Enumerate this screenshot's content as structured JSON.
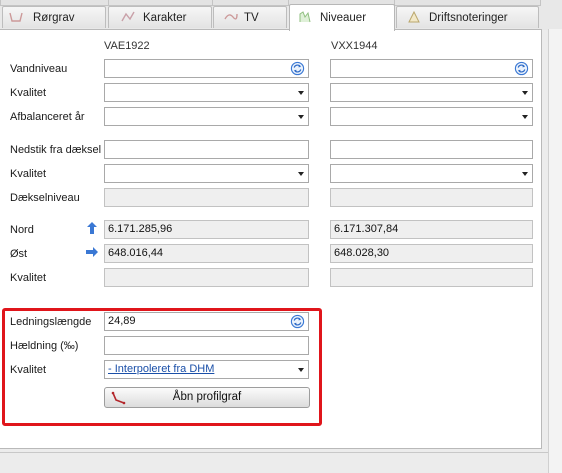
{
  "tabs": [
    {
      "label": "Rørgrav",
      "icon": "pipe-trench-icon"
    },
    {
      "label": "Karakter",
      "icon": "grade-icon"
    },
    {
      "label": "TV",
      "icon": "tv-inspection-icon"
    },
    {
      "label": "Niveauer",
      "icon": "levels-icon",
      "active": true
    },
    {
      "label": "Driftsnoteringer",
      "icon": "notes-icon"
    }
  ],
  "columns": {
    "left": "VAE1922",
    "right": "VXX1944"
  },
  "labels": {
    "vandniveau": "Vandniveau",
    "kvalitet1": "Kvalitet",
    "afbalanceret": "Afbalanceret år",
    "nedstik": "Nedstik fra dæksel",
    "kvalitet2": "Kvalitet",
    "daekselniveau": "Dækselniveau",
    "nord": "Nord",
    "oest": "Øst",
    "kvalitet3": "Kvalitet"
  },
  "values": {
    "left": {
      "nord": "6.171.285,96",
      "oest": "648.016,44"
    },
    "right": {
      "nord": "6.171.307,84",
      "oest": "648.028,30"
    }
  },
  "pipe": {
    "length_label": "Ledningslængde",
    "length_value": "24,89",
    "slope_label": "Hældning (‰)",
    "slope_value": "",
    "quality_label": "Kvalitet",
    "quality_value": "- Interpoleret fra DHM",
    "profile_button": "Åbn profilgraf"
  },
  "colors": {
    "highlight": "#e0151b",
    "link": "#1a4fa8",
    "arrow": "#3a78d4"
  }
}
